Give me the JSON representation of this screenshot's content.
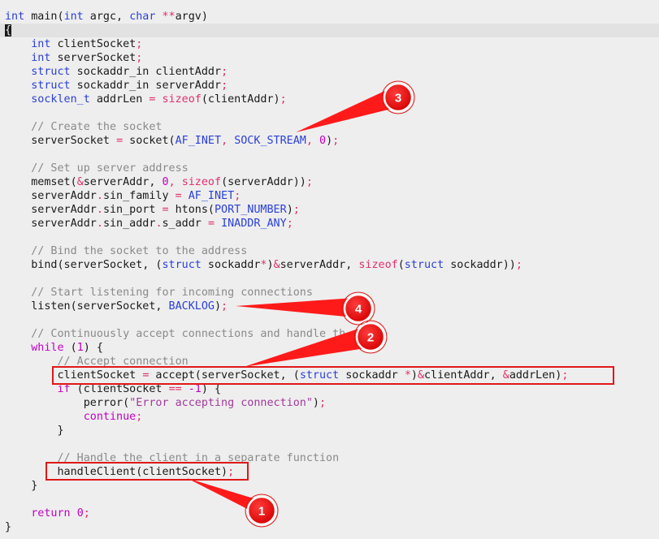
{
  "code": {
    "l1": [
      "int",
      " main(",
      "int",
      " argc, ",
      "char",
      " ",
      "**",
      "argv)"
    ],
    "l2": [
      "{"
    ],
    "l4": [
      "    ",
      "int",
      " clientSocket",
      ";"
    ],
    "l5": [
      "    ",
      "int",
      " serverSocket",
      ";"
    ],
    "l6": [
      "    ",
      "struct",
      " sockaddr_in clientAddr",
      ";"
    ],
    "l7": [
      "    ",
      "struct",
      " sockaddr_in serverAddr",
      ";"
    ],
    "l8": [
      "    ",
      "socklen_t",
      " addrLen ",
      "=",
      " ",
      "sizeof",
      "(clientAddr)",
      ";"
    ],
    "l10": [
      "    // Create the socket"
    ],
    "l11": [
      "    serverSocket ",
      "=",
      " socket(",
      "AF_INET",
      ", ",
      "SOCK_STREAM",
      ", ",
      "0",
      ")",
      ";"
    ],
    "l13": [
      "    // Set up server address"
    ],
    "l14": [
      "    memset(",
      "&",
      "serverAddr, ",
      "0",
      ", ",
      "sizeof",
      "(serverAddr))",
      ";"
    ],
    "l15": [
      "    serverAddr",
      ".",
      "sin_family ",
      "=",
      " ",
      "AF_INET",
      ";"
    ],
    "l16": [
      "    serverAddr",
      ".",
      "sin_port ",
      "=",
      " htons(",
      "PORT_NUMBER",
      ")",
      ";"
    ],
    "l17": [
      "    serverAddr",
      ".",
      "sin_addr",
      ".",
      "s_addr ",
      "=",
      " ",
      "INADDR_ANY",
      ";"
    ],
    "l19": [
      "    // Bind the socket to the address"
    ],
    "l20": [
      "    bind(serverSocket, (",
      "struct",
      " sockaddr",
      "*",
      ")",
      "&",
      "serverAddr, ",
      "sizeof",
      "(",
      "struct",
      " sockaddr))",
      ";"
    ],
    "l22": [
      "    // Start listening for incoming connections"
    ],
    "l23": [
      "    listen(serverSocket, ",
      "BACKLOG",
      ")",
      ";"
    ],
    "l25": [
      "    // Continuously accept connections and handle th"
    ],
    "l26": [
      "    ",
      "while",
      " (",
      "1",
      ") {"
    ],
    "l27": [
      "        // Accept connection"
    ],
    "l28": [
      "        clientSocket ",
      "=",
      " accept(serverSocket, (",
      "struct",
      " sockaddr ",
      "*",
      ")",
      "&",
      "clientAddr, ",
      "&",
      "addrLen)",
      ";"
    ],
    "l29": [
      "        ",
      "if",
      " (clientSocket ",
      "==",
      " ",
      "-1",
      ") {"
    ],
    "l30": [
      "            perror(",
      "\"Error accepting connection\"",
      ")",
      ";"
    ],
    "l31": [
      "            ",
      "continue",
      ";"
    ],
    "l32": [
      "        }"
    ],
    "l34": [
      "        // Handle the client in a separate function"
    ],
    "l35": [
      "        handleClient(clientSocket)",
      ";"
    ],
    "l36": [
      "    }"
    ],
    "l38": [
      "    ",
      "return",
      " ",
      "0",
      ";"
    ],
    "l39": [
      "}"
    ]
  },
  "annotations": {
    "badge1": "1",
    "badge2": "2",
    "badge3": "3",
    "badge4": "4"
  },
  "colors": {
    "keyword": "#2a3fd6",
    "control": "#c000c0",
    "operator": "#e0306a",
    "comment": "#8a8a8a",
    "annotation": "#e01818"
  }
}
